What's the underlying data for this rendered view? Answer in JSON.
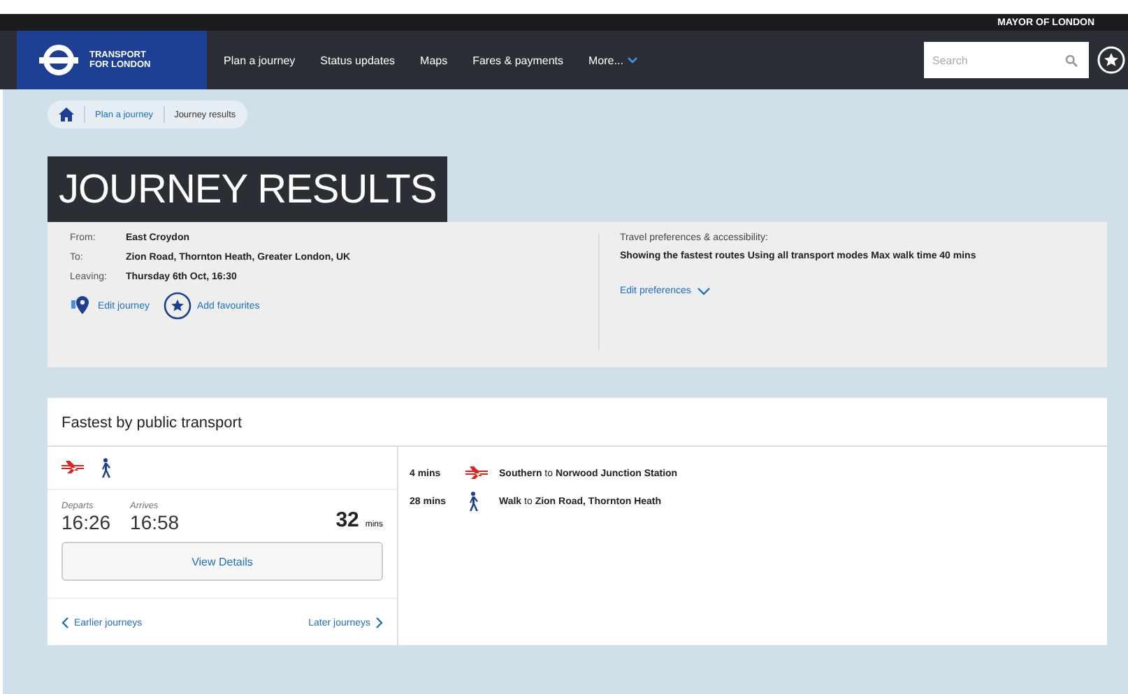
{
  "header": {
    "mayor": "MAYOR OF LONDON",
    "logo_text": [
      "TRANSPORT",
      "FOR LONDON"
    ],
    "nav": [
      {
        "label": "Plan a journey"
      },
      {
        "label": "Status updates"
      },
      {
        "label": "Maps"
      },
      {
        "label": "Fares & payments"
      },
      {
        "label": "More...",
        "dropdown": true
      }
    ],
    "search": {
      "placeholder": "Search"
    }
  },
  "breadcrumb": [
    "Plan a journey",
    "Journey results"
  ],
  "title": "JOURNEY RESULTS",
  "summary": {
    "fields": [
      {
        "label": "From:",
        "value": "East Croydon"
      },
      {
        "label": "To:",
        "value": "Zion Road, Thornton Heath, Greater London, UK"
      },
      {
        "label": "Leaving:",
        "value": "Thursday 6th Oct, 16:30"
      }
    ],
    "actions": [
      {
        "kind": "pin",
        "label": "Edit journey"
      },
      {
        "kind": "star",
        "label": "Add favourites"
      }
    ],
    "prefs_heading": "Travel preferences & accessibility:",
    "prefs_text": "Showing the fastest routes Using all transport modes Max walk time 40 mins",
    "prefs_link": "Edit preferences"
  },
  "result": {
    "heading": "Fastest by public transport",
    "modes": [
      {
        "kind": "rail"
      },
      {
        "kind": "walk"
      }
    ],
    "departs_label": "Departs",
    "departs": "16:26",
    "arrives_label": "Arrives",
    "arrives": "16:58",
    "duration": "32",
    "duration_unit": "mins",
    "details_button": "View Details",
    "earlier": "Earlier journeys",
    "later": "Later journeys",
    "steps": [
      {
        "kind": "rail",
        "duration": "4 mins",
        "operator": "Southern",
        "joiner": "to",
        "destination": "Norwood Junction Station"
      },
      {
        "kind": "walk",
        "duration": "28 mins",
        "operator": "Walk",
        "joiner": "to",
        "destination": "Zion Road, Thornton Heath"
      }
    ]
  }
}
